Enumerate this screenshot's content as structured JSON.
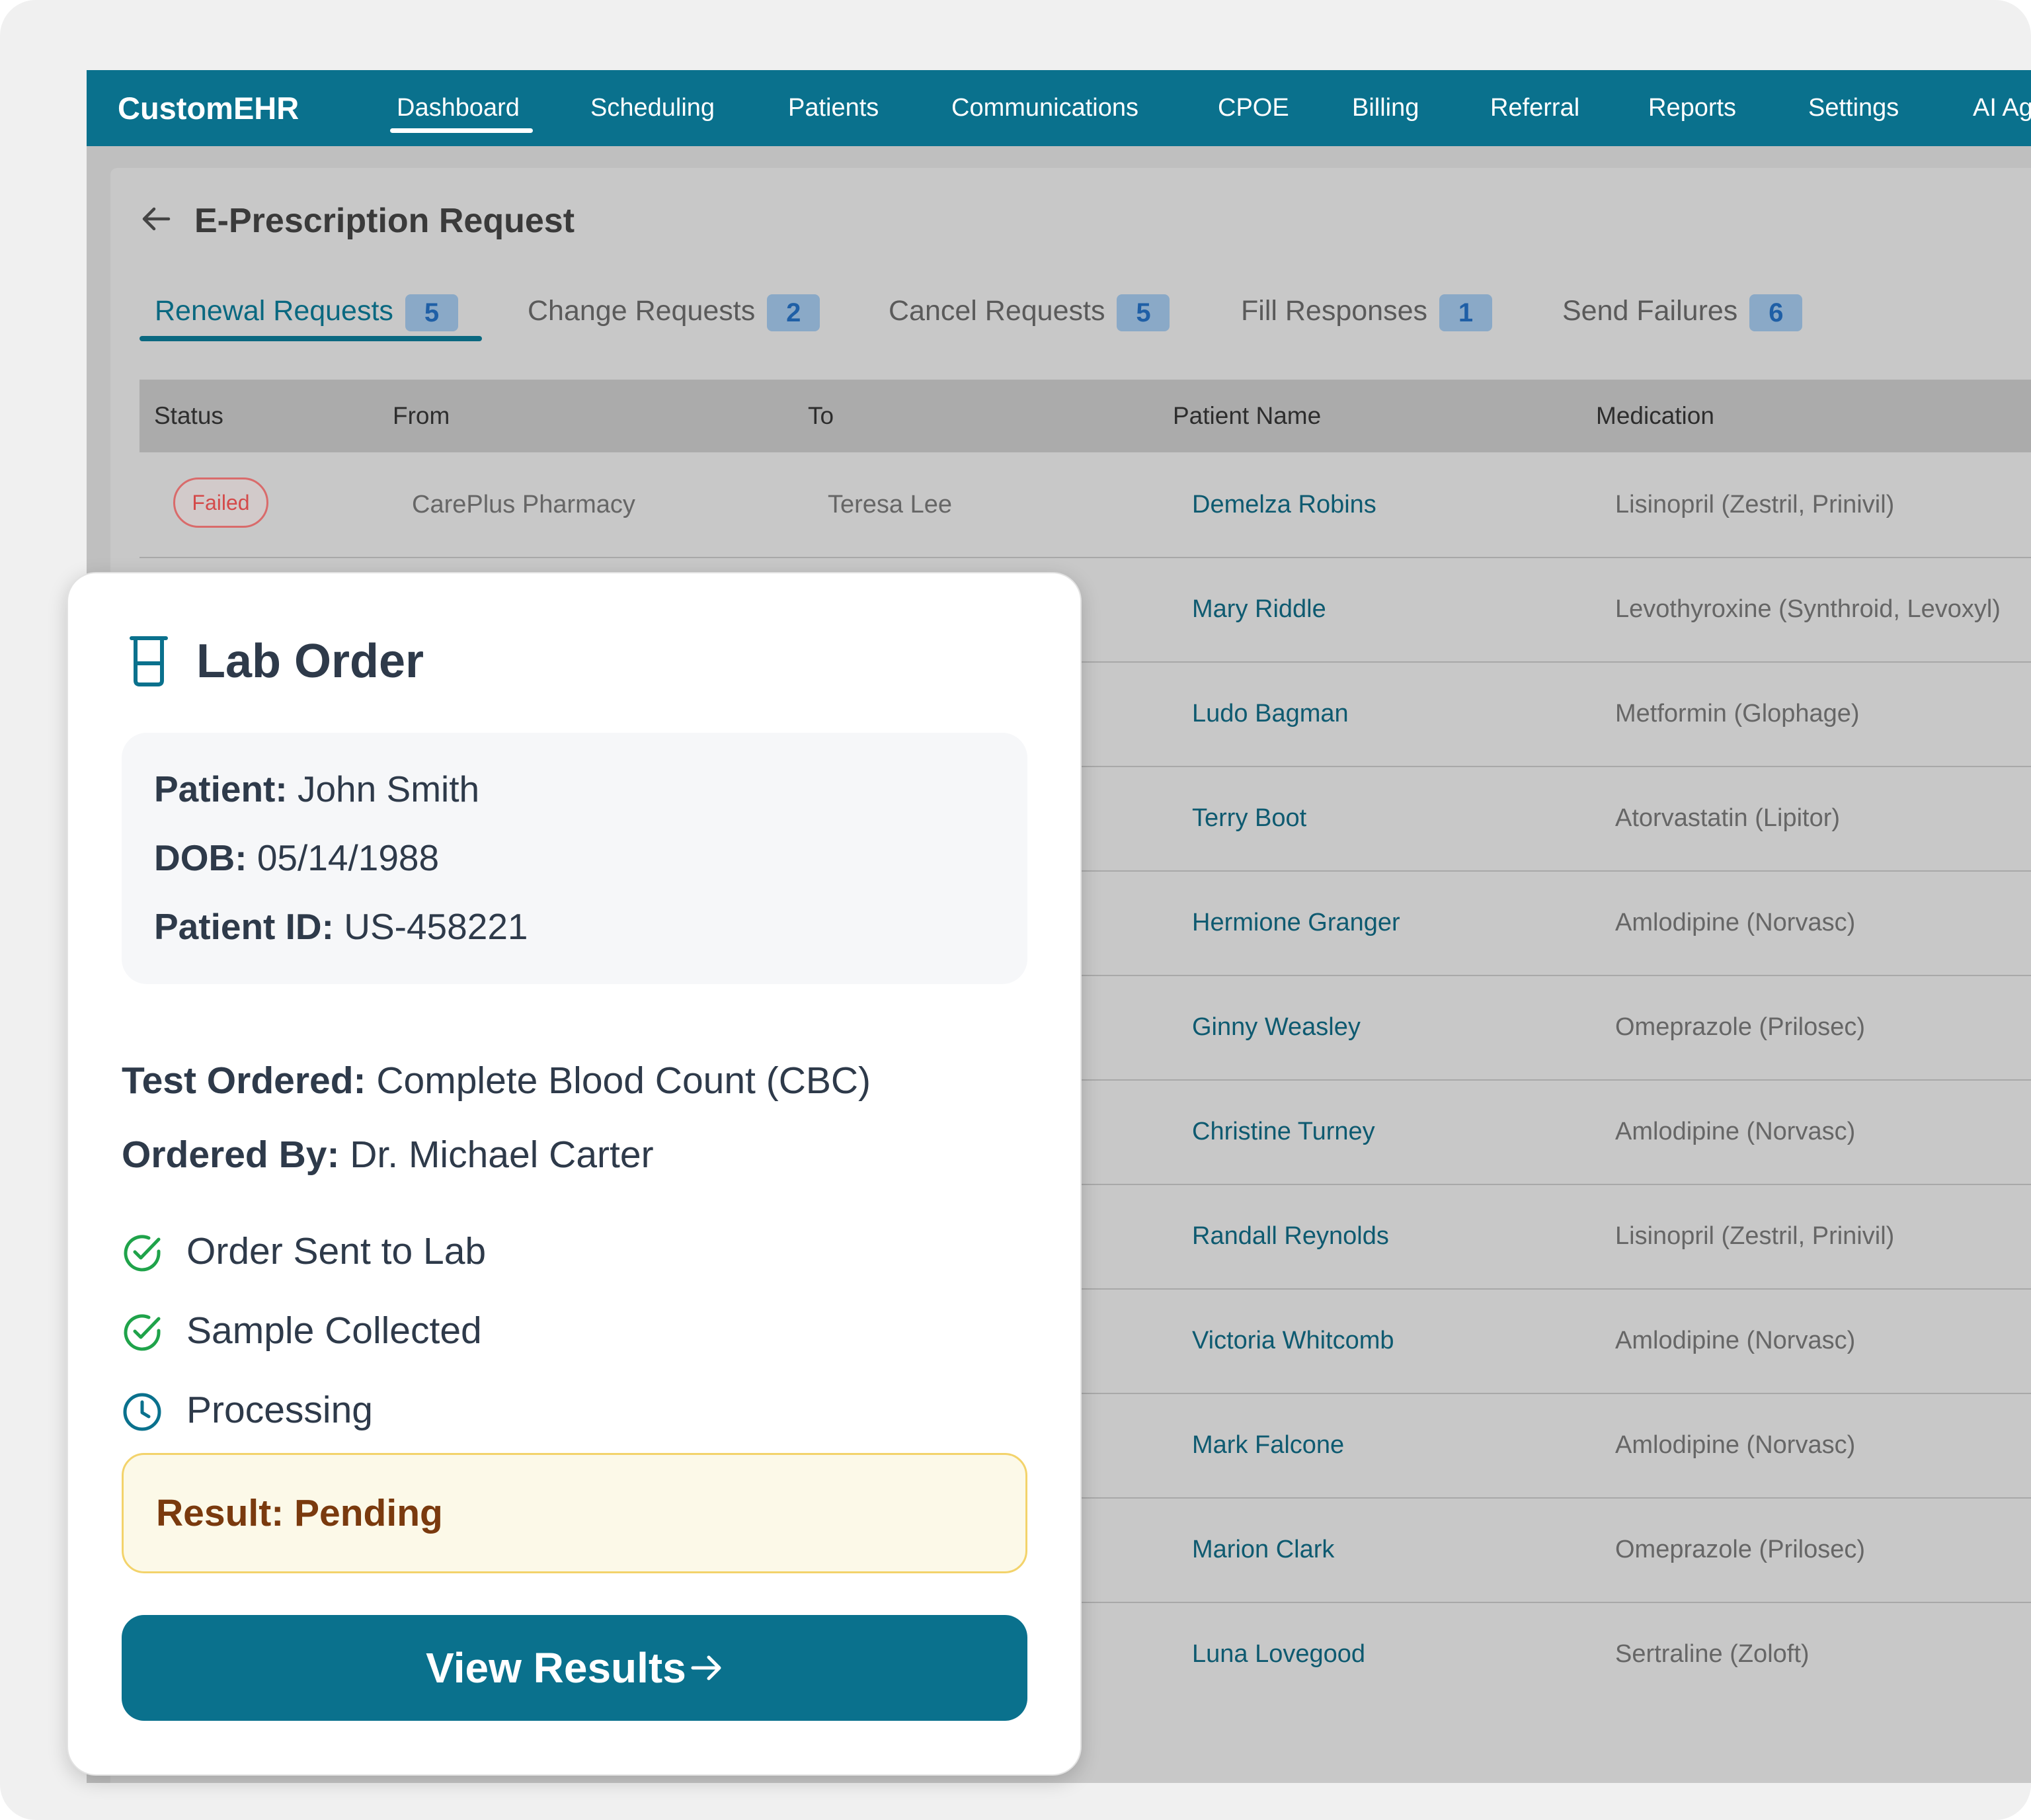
{
  "brand": "CustomEHR",
  "nav": {
    "items": [
      {
        "label": "Dashboard",
        "active": true
      },
      {
        "label": "Scheduling"
      },
      {
        "label": "Patients"
      },
      {
        "label": "Communications"
      },
      {
        "label": "CPOE"
      },
      {
        "label": "Billing"
      },
      {
        "label": "Referral"
      },
      {
        "label": "Reports"
      },
      {
        "label": "Settings"
      },
      {
        "label": "AI Ag"
      }
    ]
  },
  "page": {
    "title": "E-Prescription Request",
    "tabs": [
      {
        "label": "Renewal Requests",
        "count": "5",
        "active": true
      },
      {
        "label": "Change Requests",
        "count": "2"
      },
      {
        "label": "Cancel Requests",
        "count": "5"
      },
      {
        "label": "Fill Responses",
        "count": "1"
      },
      {
        "label": "Send Failures",
        "count": "6"
      }
    ]
  },
  "table": {
    "columns": [
      "Status",
      "From",
      "To",
      "Patient Name",
      "Medication"
    ],
    "rows": [
      {
        "status": "Failed",
        "from": "CarePlus Pharmacy",
        "to": "Teresa Lee",
        "patient": "Demelza Robins",
        "medication": "Lisinopril (Zestril, Prinivil)"
      },
      {
        "patient": "Mary Riddle",
        "medication": "Levothyroxine (Synthroid, Levoxyl)"
      },
      {
        "patient": "Ludo Bagman",
        "medication": "Metformin (Glophage)"
      },
      {
        "patient": "Terry Boot",
        "medication": "Atorvastatin (Lipitor)"
      },
      {
        "patient": "Hermione Granger",
        "medication": "Amlodipine (Norvasc)"
      },
      {
        "patient": "Ginny Weasley",
        "medication": "Omeprazole (Prilosec)"
      },
      {
        "patient": "Christine Turney",
        "medication": "Amlodipine (Norvasc)"
      },
      {
        "patient": "Randall Reynolds",
        "medication": "Lisinopril (Zestril, Prinivil)"
      },
      {
        "patient": "Victoria Whitcomb",
        "medication": "Amlodipine (Norvasc)"
      },
      {
        "patient": "Mark Falcone",
        "medication": "Amlodipine (Norvasc)"
      },
      {
        "patient": "Marion Clark",
        "medication": "Omeprazole (Prilosec)"
      },
      {
        "patient": "Luna Lovegood",
        "medication": "Sertraline (Zoloft)"
      }
    ]
  },
  "lab_order": {
    "title": "Lab Order",
    "icon": "beaker-icon",
    "patient_label": "Patient:",
    "patient_value": "John Smith",
    "dob_label": "DOB:",
    "dob_value": "05/14/1988",
    "id_label": "Patient ID:",
    "id_value": "US-458221",
    "test_label": "Test Ordered:",
    "test_value": "Complete Blood Count (CBC)",
    "ordered_by_label": "Ordered By:",
    "ordered_by_value": "Dr. Michael Carter",
    "steps": [
      {
        "label": "Order Sent to Lab",
        "state": "done",
        "icon": "check-circle-icon"
      },
      {
        "label": "Sample Collected",
        "state": "done",
        "icon": "check-circle-icon"
      },
      {
        "label": "Processing",
        "state": "in-progress",
        "icon": "clock-icon"
      }
    ],
    "result": "Result: Pending",
    "button": "View Results",
    "colors": {
      "primary": "#0a718d",
      "success": "#1fa34a",
      "warning_bg": "#fcf9e8",
      "warning_text": "#7a3a0e"
    }
  }
}
